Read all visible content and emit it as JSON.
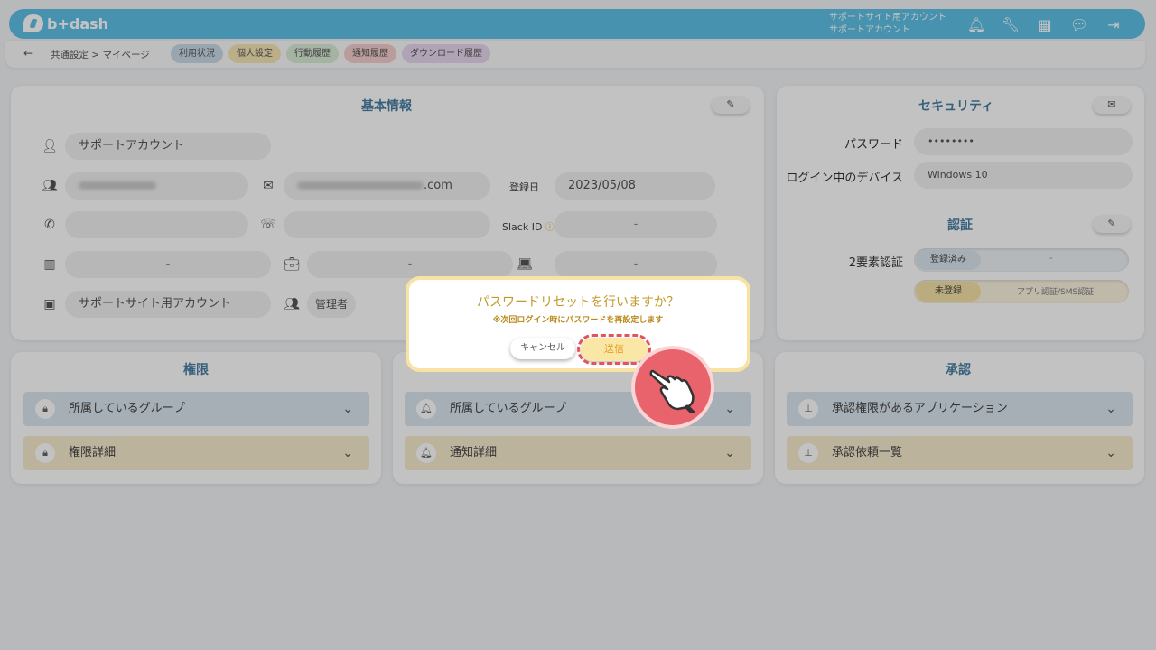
{
  "header": {
    "logo_text": "b+dash",
    "account_line1": "サポートサイト用アカウント",
    "account_line2": "サポートアカウント",
    "icons": [
      "bell-icon",
      "wrench-icon",
      "grid-icon",
      "chat-icon",
      "logout-icon"
    ]
  },
  "subbar": {
    "back_glyph": "←",
    "breadcrumb": "共通設定 > マイページ",
    "tabs": [
      "利用状況",
      "個人設定",
      "行動履歴",
      "通知履歴",
      "ダウンロード履歴"
    ]
  },
  "basic": {
    "title": "基本情報",
    "name": "サポートアカウント",
    "email_suffix": ".com",
    "reg_label": "登録日",
    "reg_date": "2023/05/08",
    "slack_label": "Slack ID",
    "slack_value": "-",
    "dept_value": "-",
    "post_value": "-",
    "pc_value": "-",
    "group_value": "サポートサイト用アカウント",
    "role_value": "管理者"
  },
  "security": {
    "title": "セキュリティ",
    "password_label": "パスワード",
    "password_value": "••••••••",
    "device_label": "ログイン中のデバイス",
    "device_value": "Windows 10",
    "auth_title": "認証",
    "twofa_label": "2要素認証",
    "twofa_state1": "登録済み",
    "twofa_value1": "-",
    "twofa_state2": "未登録",
    "twofa_value2": "アプリ認証/SMS認証"
  },
  "permissions": {
    "title": "権限",
    "item1": "所属しているグループ",
    "item2": "権限詳細"
  },
  "notifications": {
    "item1": "所属しているグループ",
    "item2": "通知詳細"
  },
  "approval": {
    "title": "承認",
    "item1": "承認権限があるアプリケーション",
    "item2": "承認依頼一覧"
  },
  "modal": {
    "title": "パスワードリセットを行いますか？",
    "subtitle": "※次回ログイン時にパスワードを再設定します",
    "cancel_label": "キャンセル",
    "send_label": "送信"
  }
}
